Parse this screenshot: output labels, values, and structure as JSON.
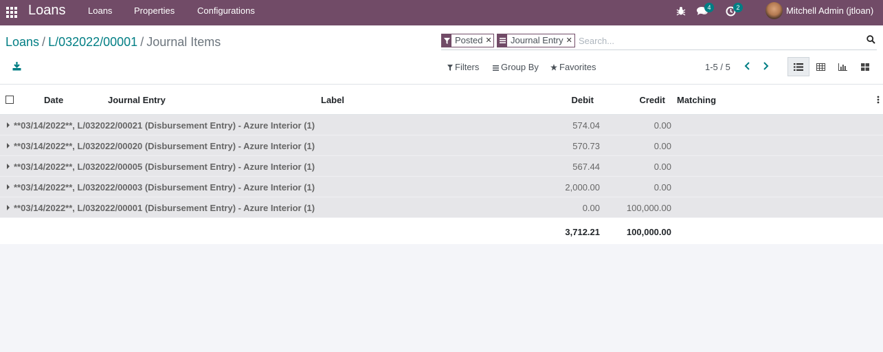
{
  "app": {
    "brand": "Loans"
  },
  "menu": [
    "Loans",
    "Properties",
    "Configurations"
  ],
  "systray": {
    "messages_count": "4",
    "activities_count": "2",
    "user_name": "Mitchell Admin (jtloan)"
  },
  "breadcrumb": {
    "items": [
      "Loans",
      "L/032022/00001"
    ],
    "current": "Journal Items"
  },
  "search": {
    "facets": [
      {
        "icon": "filter-icon",
        "value": "Posted"
      },
      {
        "icon": "group-by-icon",
        "value": "Journal Entry"
      }
    ],
    "placeholder": "Search..."
  },
  "controls": {
    "filters": "Filters",
    "group_by": "Group By",
    "favorites": "Favorites"
  },
  "pager": {
    "value": "1-5 / 5"
  },
  "columns": {
    "date": "Date",
    "journal_entry": "Journal Entry",
    "label": "Label",
    "debit": "Debit",
    "credit": "Credit",
    "matching": "Matching"
  },
  "groups": [
    {
      "label": "**03/14/2022**, L/032022/00021 (Disbursement Entry) - Azure Interior (1)",
      "debit": "574.04",
      "credit": "0.00"
    },
    {
      "label": "**03/14/2022**, L/032022/00020 (Disbursement Entry) - Azure Interior (1)",
      "debit": "570.73",
      "credit": "0.00"
    },
    {
      "label": "**03/14/2022**, L/032022/00005 (Disbursement Entry) - Azure Interior (1)",
      "debit": "567.44",
      "credit": "0.00"
    },
    {
      "label": "**03/14/2022**, L/032022/00003 (Disbursement Entry) - Azure Interior (1)",
      "debit": "2,000.00",
      "credit": "0.00"
    },
    {
      "label": "**03/14/2022**, L/032022/00001 (Disbursement Entry) - Azure Interior (1)",
      "debit": "0.00",
      "credit": "100,000.00"
    }
  ],
  "totals": {
    "debit": "3,712.21",
    "credit": "100,000.00"
  },
  "colors": {
    "navbar": "#714b67",
    "link": "#017e84",
    "badge": "#017e84"
  }
}
